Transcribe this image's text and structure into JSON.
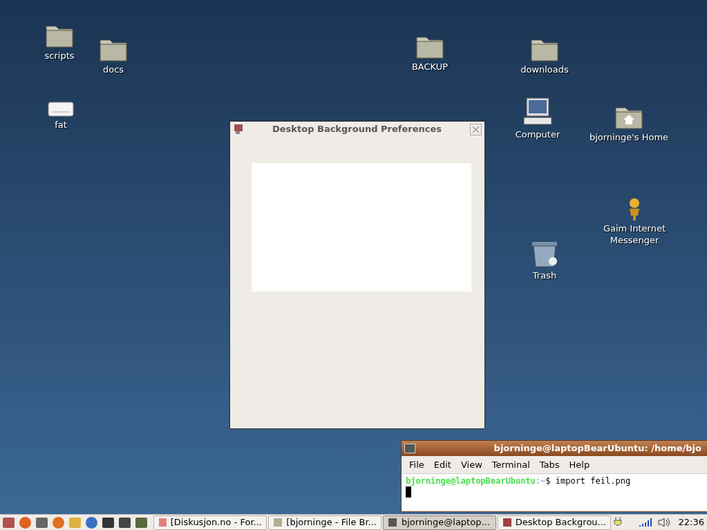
{
  "desktop_icons": [
    {
      "label": "scripts",
      "kind": "folder"
    },
    {
      "label": "docs",
      "kind": "folder"
    },
    {
      "label": "BACKUP",
      "kind": "folder"
    },
    {
      "label": "downloads",
      "kind": "folder"
    },
    {
      "label": "fat",
      "kind": "drive"
    },
    {
      "label": "Computer",
      "kind": "computer"
    },
    {
      "label": "bjorninge's Home",
      "kind": "home"
    },
    {
      "label": "Gaim Internet Messenger",
      "kind": "person"
    },
    {
      "label": "Trash",
      "kind": "trash"
    }
  ],
  "dialog": {
    "title": "Desktop Background Preferences"
  },
  "terminal": {
    "title": "bjorninge@laptopBearUbuntu: /home/bjo",
    "menu": [
      "File",
      "Edit",
      "View",
      "Terminal",
      "Tabs",
      "Help"
    ],
    "prompt_user": "bjorninge@laptopBearUbuntu",
    "prompt_path": ":~",
    "command": "$ import feil.png"
  },
  "taskbar": {
    "launchers": [
      {
        "kind": "toolbox"
      },
      {
        "kind": "ubuntu"
      },
      {
        "kind": "screenshot"
      },
      {
        "kind": "firefox"
      },
      {
        "kind": "person"
      },
      {
        "kind": "thunderbird"
      },
      {
        "kind": "terminal"
      },
      {
        "kind": "terminal2"
      },
      {
        "kind": "bug"
      }
    ],
    "tasks": [
      {
        "label": "[Diskusjon.no - For...",
        "kind": "browser",
        "selected": false
      },
      {
        "label": "[bjorninge - File Br...",
        "kind": "files",
        "selected": false
      },
      {
        "label": "bjorninge@laptop...",
        "kind": "terminal",
        "selected": true
      },
      {
        "label": "Desktop Backgrou...",
        "kind": "prefs",
        "selected": false
      }
    ],
    "clock": "22:36"
  }
}
